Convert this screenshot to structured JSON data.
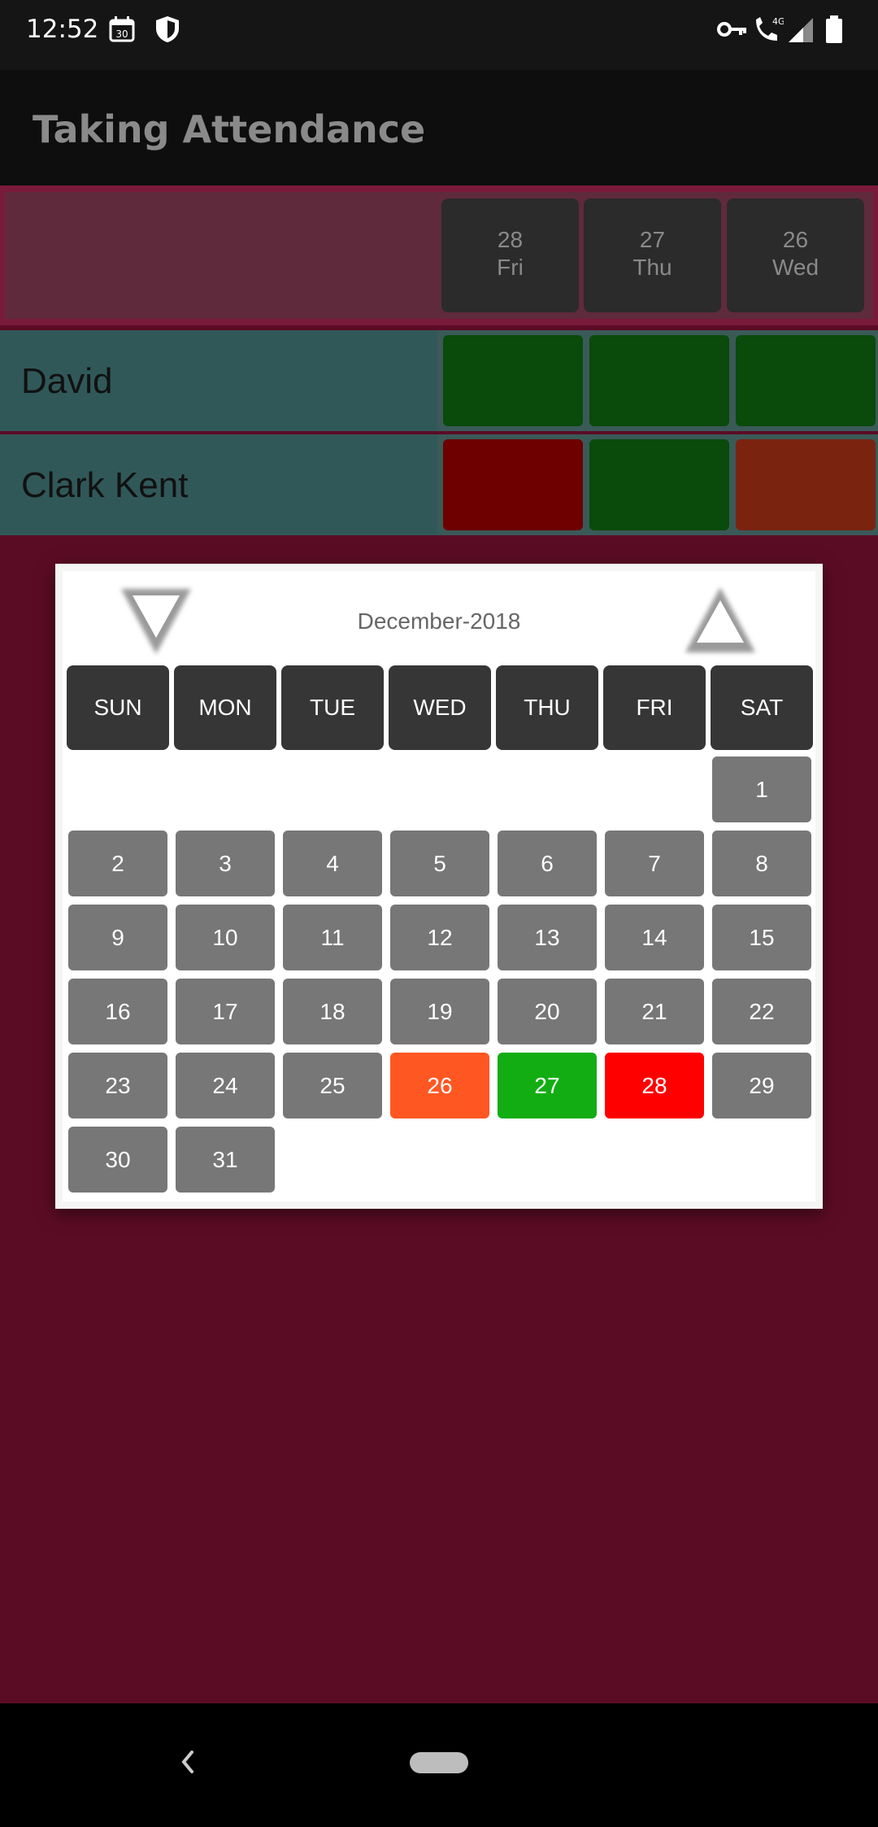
{
  "status_bar": {
    "time": "12:52",
    "network": "4G"
  },
  "app": {
    "title": "Taking Attendance"
  },
  "header": {
    "dates": [
      {
        "day": "28",
        "weekday": "Fri"
      },
      {
        "day": "27",
        "weekday": "Thu"
      },
      {
        "day": "26",
        "weekday": "Wed"
      }
    ]
  },
  "students": [
    {
      "name": "David",
      "attendance": [
        "present",
        "present",
        "present"
      ]
    },
    {
      "name": "Clark Kent",
      "attendance": [
        "absent",
        "present",
        "late"
      ]
    }
  ],
  "colors": {
    "present_row": "#0a4a0a",
    "absent_row": "#6e0000",
    "late_row": "#7a2410",
    "cal_absent": "#ff0000",
    "cal_present": "#12ad12",
    "cal_late": "#ff5722",
    "cal_default": "#777777"
  },
  "calendar": {
    "month_label": "December-2018",
    "prev_icon": "triangle-down-icon",
    "next_icon": "triangle-up-icon",
    "weekdays": [
      "SUN",
      "MON",
      "TUE",
      "WED",
      "THU",
      "FRI",
      "SAT"
    ],
    "days": [
      "1",
      "2",
      "3",
      "4",
      "5",
      "6",
      "7",
      "8",
      "9",
      "10",
      "11",
      "12",
      "13",
      "14",
      "15",
      "16",
      "17",
      "18",
      "19",
      "20",
      "21",
      "22",
      "23",
      "24",
      "25",
      "26",
      "27",
      "28",
      "29",
      "30",
      "31"
    ],
    "highlighted": {
      "26": "late",
      "27": "present",
      "28": "absent"
    }
  },
  "nav_bar": {
    "back_icon": "back-chevron-icon",
    "home_icon": "home-pill-icon"
  }
}
